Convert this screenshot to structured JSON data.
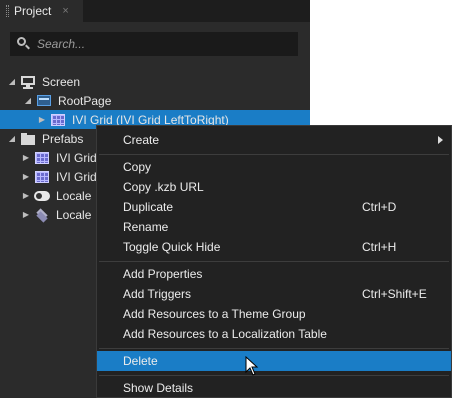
{
  "panel": {
    "tab_label": "Project",
    "tab_close": "×",
    "search_placeholder": "Search..."
  },
  "tree": [
    {
      "label": "Screen",
      "icon": "monitor-icon",
      "expanded": true
    },
    {
      "label": "RootPage",
      "icon": "page-icon",
      "expanded": true
    },
    {
      "label": "IVI Grid (IVI Grid LeftToRight)",
      "icon": "grid-icon",
      "expanded": false,
      "selected": true
    },
    {
      "label": "Prefabs",
      "icon": "folder-icon",
      "expanded": true
    },
    {
      "label": "IVI Grid",
      "icon": "grid-icon",
      "expanded": false
    },
    {
      "label": "IVI Grid",
      "icon": "grid-icon",
      "expanded": false
    },
    {
      "label": "Locale",
      "icon": "toggle-icon",
      "expanded": false
    },
    {
      "label": "Locale",
      "icon": "layers-icon",
      "expanded": false
    }
  ],
  "menu": {
    "create": "Create",
    "copy": "Copy",
    "copy_kzb": "Copy .kzb URL",
    "duplicate": "Duplicate",
    "duplicate_shortcut": "Ctrl+D",
    "rename": "Rename",
    "toggle_quick_hide": "Toggle Quick Hide",
    "toggle_quick_hide_shortcut": "Ctrl+H",
    "add_properties": "Add Properties",
    "add_triggers": "Add Triggers",
    "add_triggers_shortcut": "Ctrl+Shift+E",
    "add_theme_group": "Add Resources to a Theme Group",
    "add_localization": "Add Resources to a Localization Table",
    "delete": "Delete",
    "show_details": "Show Details"
  },
  "colors": {
    "selection": "#1a7dc6",
    "panel_bg": "#2b2b2b",
    "menu_bg": "#222222"
  }
}
